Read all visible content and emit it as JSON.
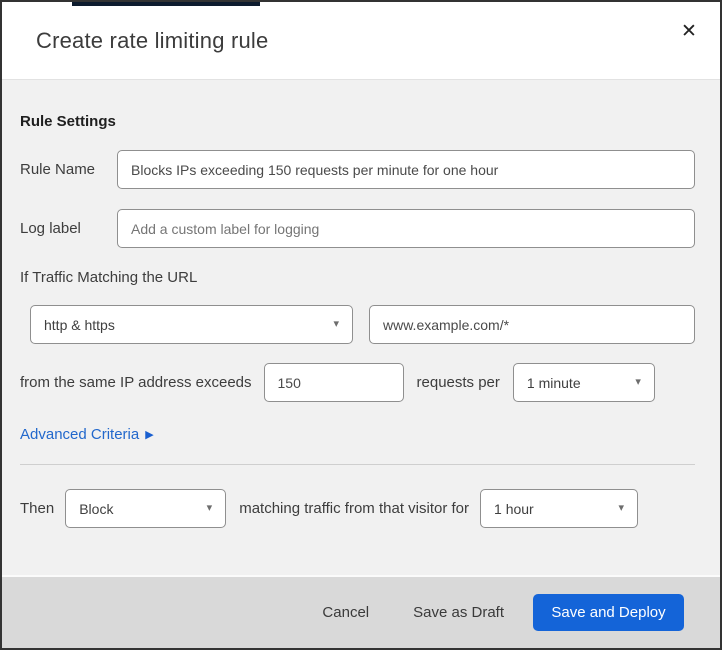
{
  "dialog": {
    "title": "Create rate limiting rule"
  },
  "icons": {
    "close": "✕",
    "caret_down": "▾",
    "arrow_right": "▶"
  },
  "section": {
    "heading": "Rule Settings"
  },
  "fields": {
    "rule_name": {
      "label": "Rule Name",
      "value": "Blocks IPs exceeding 150 requests per minute for one hour"
    },
    "log_label": {
      "label": "Log label",
      "placeholder": "Add a custom label for logging"
    }
  },
  "match": {
    "intro": "If Traffic Matching the URL",
    "scheme_select": {
      "value": "http & https"
    },
    "url_input": {
      "value": "www.example.com/*"
    },
    "threshold_text_before": "from the same IP address exceeds",
    "threshold_value": "150",
    "threshold_text_after": "requests per",
    "period_select": {
      "value": "1 minute"
    },
    "advanced_link": "Advanced Criteria"
  },
  "action": {
    "then_label": "Then",
    "action_select": {
      "value": "Block"
    },
    "middle_text": "matching traffic from that visitor for",
    "duration_select": {
      "value": "1 hour"
    }
  },
  "footer": {
    "cancel_label": "Cancel",
    "save_draft_label": "Save as Draft",
    "save_deploy_label": "Save and Deploy"
  },
  "colors": {
    "primary_button_blue": "#1464d8",
    "link_blue": "#2268cc",
    "body_background": "#f1f1f1",
    "footer_background": "#d9d9d9",
    "dialog_border": "#333333",
    "top_accent_bar": "#0d1b2e",
    "input_border": "#8f8f8f"
  }
}
